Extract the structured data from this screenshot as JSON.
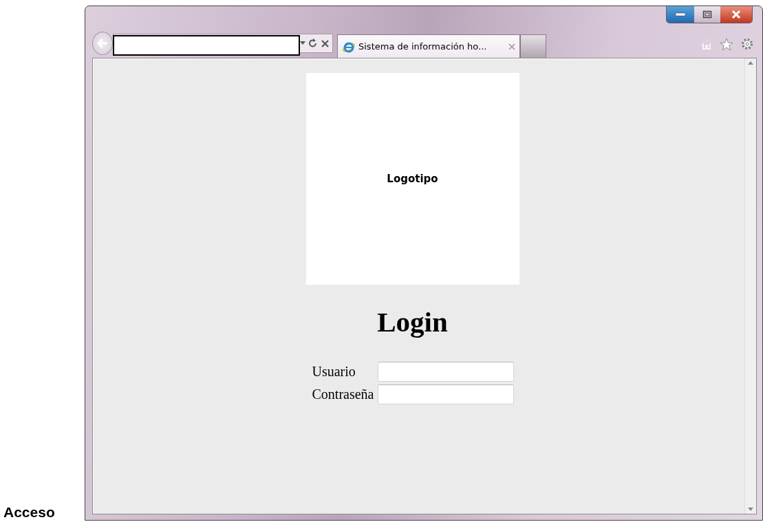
{
  "caption": "Acceso",
  "browser": {
    "tab": {
      "title": "Sistema de información ho...",
      "selected": true
    }
  },
  "page": {
    "logo": "Logotipo",
    "heading": "Login",
    "fields": [
      {
        "label": "Usuario"
      },
      {
        "label": "Contraseña"
      }
    ]
  }
}
